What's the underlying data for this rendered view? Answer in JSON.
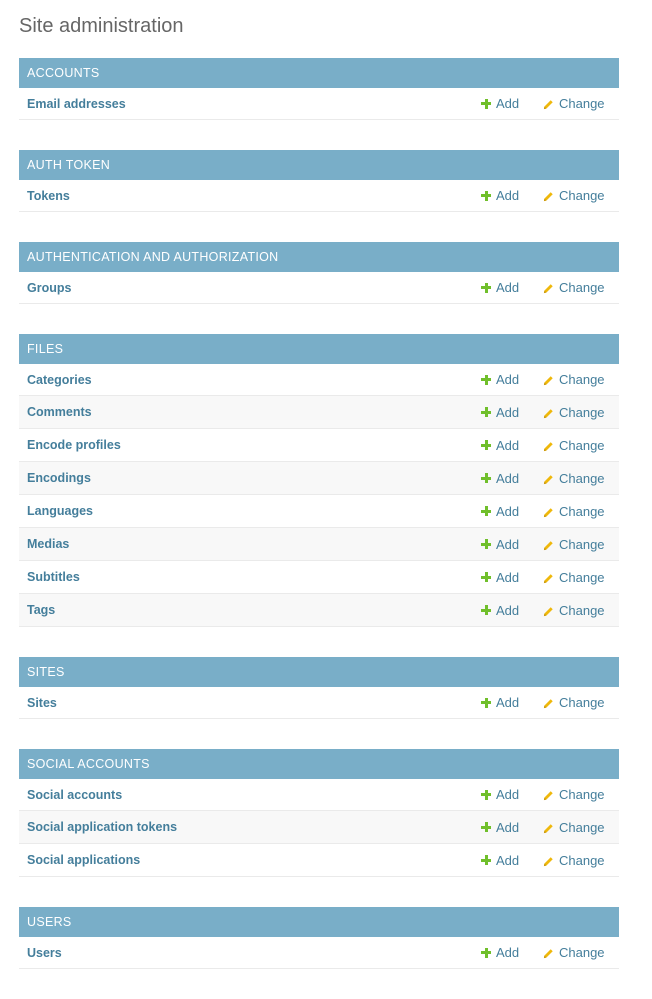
{
  "page": {
    "title": "Site administration"
  },
  "colors": {
    "header_bg": "#79aec8",
    "link": "#447e9b",
    "add_icon": "#70bf2b",
    "change_icon": "#efb80b"
  },
  "actions": {
    "add_label": "Add",
    "change_label": "Change",
    "add_icon": "plus-icon",
    "change_icon": "pencil-icon"
  },
  "modules": [
    {
      "title": "ACCOUNTS",
      "models": [
        "Email addresses"
      ]
    },
    {
      "title": "AUTH TOKEN",
      "models": [
        "Tokens"
      ]
    },
    {
      "title": "AUTHENTICATION AND AUTHORIZATION",
      "models": [
        "Groups"
      ]
    },
    {
      "title": "FILES",
      "models": [
        "Categories",
        "Comments",
        "Encode profiles",
        "Encodings",
        "Languages",
        "Medias",
        "Subtitles",
        "Tags"
      ]
    },
    {
      "title": "SITES",
      "models": [
        "Sites"
      ]
    },
    {
      "title": "SOCIAL ACCOUNTS",
      "models": [
        "Social accounts",
        "Social application tokens",
        "Social applications"
      ]
    },
    {
      "title": "USERS",
      "models": [
        "Users"
      ]
    }
  ]
}
